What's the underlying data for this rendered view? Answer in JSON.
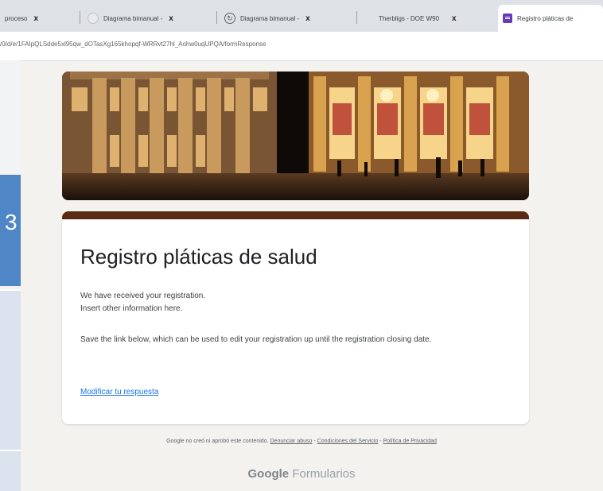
{
  "browser": {
    "tabs": [
      {
        "title": "proceso",
        "active": false
      },
      {
        "title": "Diagrama bimanual -",
        "active": false
      },
      {
        "title": "Diagrama bimanual -",
        "active": false
      },
      {
        "title": "Therbligs - DOE W90",
        "active": false
      },
      {
        "title": "Registro pláticas de",
        "active": true
      }
    ],
    "close_glyph": "x",
    "url": "/0/d/e/1FAIpQLSdde5xl95qw_dOTasXg165khopqf-WRRvt27hl_Aohw0uqUPQA/formResponse"
  },
  "left_panel": {
    "glyph": "3"
  },
  "form": {
    "title": "Registro pláticas de salud",
    "message_line1": "We have received your registration.",
    "message_line2": "Insert other information here.",
    "message_edit": "Save the link below, which can be used to edit your registration up until the registration closing date.",
    "edit_link": "Modificar tu respuesta",
    "accent_color": "#5a2a14"
  },
  "footer": {
    "disclaimer": "Google no creó ni aprobó este contenido.",
    "report_abuse": "Denunciar abuso",
    "terms": "Condiciones del Servicio",
    "privacy": "Política de Privacidad",
    "separator": " - ",
    "brand_google": "Google",
    "brand_product": "Formularios"
  }
}
